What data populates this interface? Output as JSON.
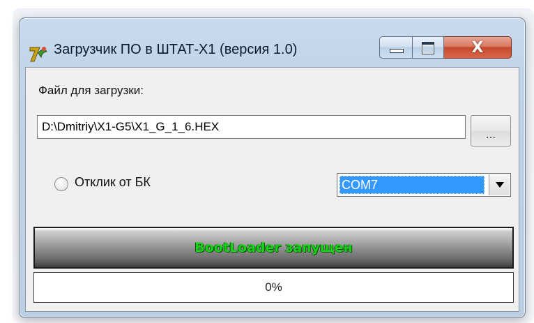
{
  "window": {
    "title": "Загрузчик ПО в ШТАТ-X1 (версия 1.0)",
    "app_icon": "delphi-app-icon",
    "close_glyph": "X"
  },
  "form": {
    "file_label": "Файл для загрузки:",
    "file_path": "D:\\Dmitriy\\X1-G5\\X1_G_1_6.HEX",
    "browse_label": "...",
    "radio_label": "Отклик от БК",
    "radio_checked": false,
    "port_selected": "COM7"
  },
  "status": {
    "text": "BootLoader запущен",
    "text_color": "#1ad11a"
  },
  "progress": {
    "value": 0,
    "text": "0%"
  }
}
